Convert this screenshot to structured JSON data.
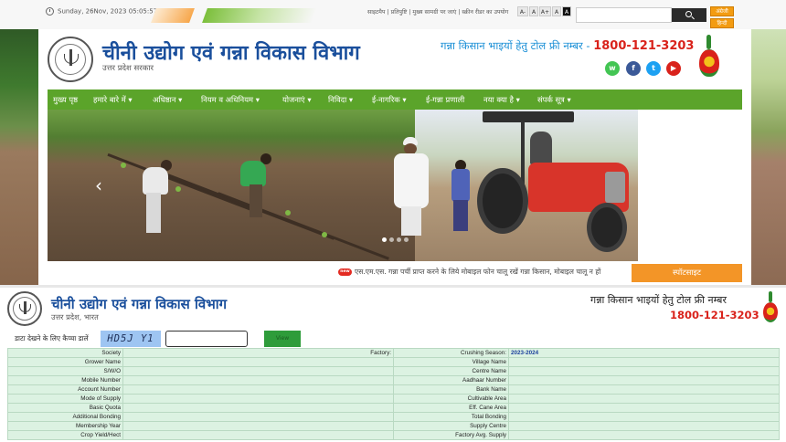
{
  "topbar": {
    "date": "Sunday, 26Nov, 2023 05:05:57 PM",
    "links": "साइटमैप | प्रतिपुष्टि | मुख्य सामग्री पर जाएं | स्क्रीन रीडर का उपयोग",
    "font_buttons": [
      "A-",
      "A",
      "A+",
      "A",
      "A"
    ],
    "lang_buttons": [
      "अंग्रेजी",
      "हिन्दी"
    ]
  },
  "header": {
    "title": "चीनी उद्योग एवं गन्ना विकास विभाग",
    "subtitle": "उत्तर प्रदेश सरकार",
    "tollfree_label": "गन्ना किसान भाइयों हेतु टोल फ्री नम्बर - ",
    "tollfree_number": "1800-121-3203",
    "social_icons": [
      "whatsapp-icon",
      "facebook-icon",
      "twitter-icon",
      "youtube-icon"
    ]
  },
  "nav": {
    "items": [
      "मुख्य पृष्ठ",
      "हमारे बारे में ▾",
      "अधिष्ठान ▾",
      "नियम व अधिनियम ▾",
      "योजनाएं ▾",
      "निविदा ▾",
      "ई-नागरिक ▾",
      "ई-गन्ना प्रणाली",
      "नया क्या है ▾",
      "संपर्क सूत्र ▾"
    ]
  },
  "slider": {
    "prev_symbol": "‹",
    "next_symbol": "›"
  },
  "ticker": {
    "badge": "new",
    "text": "एस.एम.एस. गन्ना पर्ची प्राप्त करने के लिये मोबाइल फोन चालू रखें गन्ना किसान, मोबाइल चालू न हों",
    "spotsite": "स्पॉटसाइट"
  },
  "report_header": {
    "title": "चीनी उद्योग एवं गन्ना विकास विभाग",
    "subtitle": "उत्तर प्रदेश, भारत",
    "tollfree_label": "गन्ना किसान भाइयों हेतु टोल फ्री नम्बर",
    "tollfree_number": "1800-121-3203"
  },
  "lookup": {
    "label": "डाटा देखने के लिए कैप्चा डालें",
    "captcha": "HD5J Y1",
    "input_value": "",
    "button": "View"
  },
  "table": {
    "society_label": "Society",
    "factory_label": "Factory:",
    "season_label": "Crushing Season:",
    "season_value": "2023-2024",
    "rows": [
      [
        "Grower Name",
        "Village Name"
      ],
      [
        "S/W/O",
        "Centre Name"
      ],
      [
        "Mobile Number",
        "Aadhaar Number"
      ],
      [
        "Account Number",
        "Bank Name"
      ],
      [
        "Mode of Supply",
        "Cultivable Area"
      ],
      [
        "Basic Quota",
        "Eff. Cane Area"
      ],
      [
        "Additional Bonding",
        "Total Bonding"
      ],
      [
        "Membership Year",
        "Supply Centre"
      ],
      [
        "Crop Yield/Hect",
        "Factory Avg. Supply"
      ]
    ]
  }
}
